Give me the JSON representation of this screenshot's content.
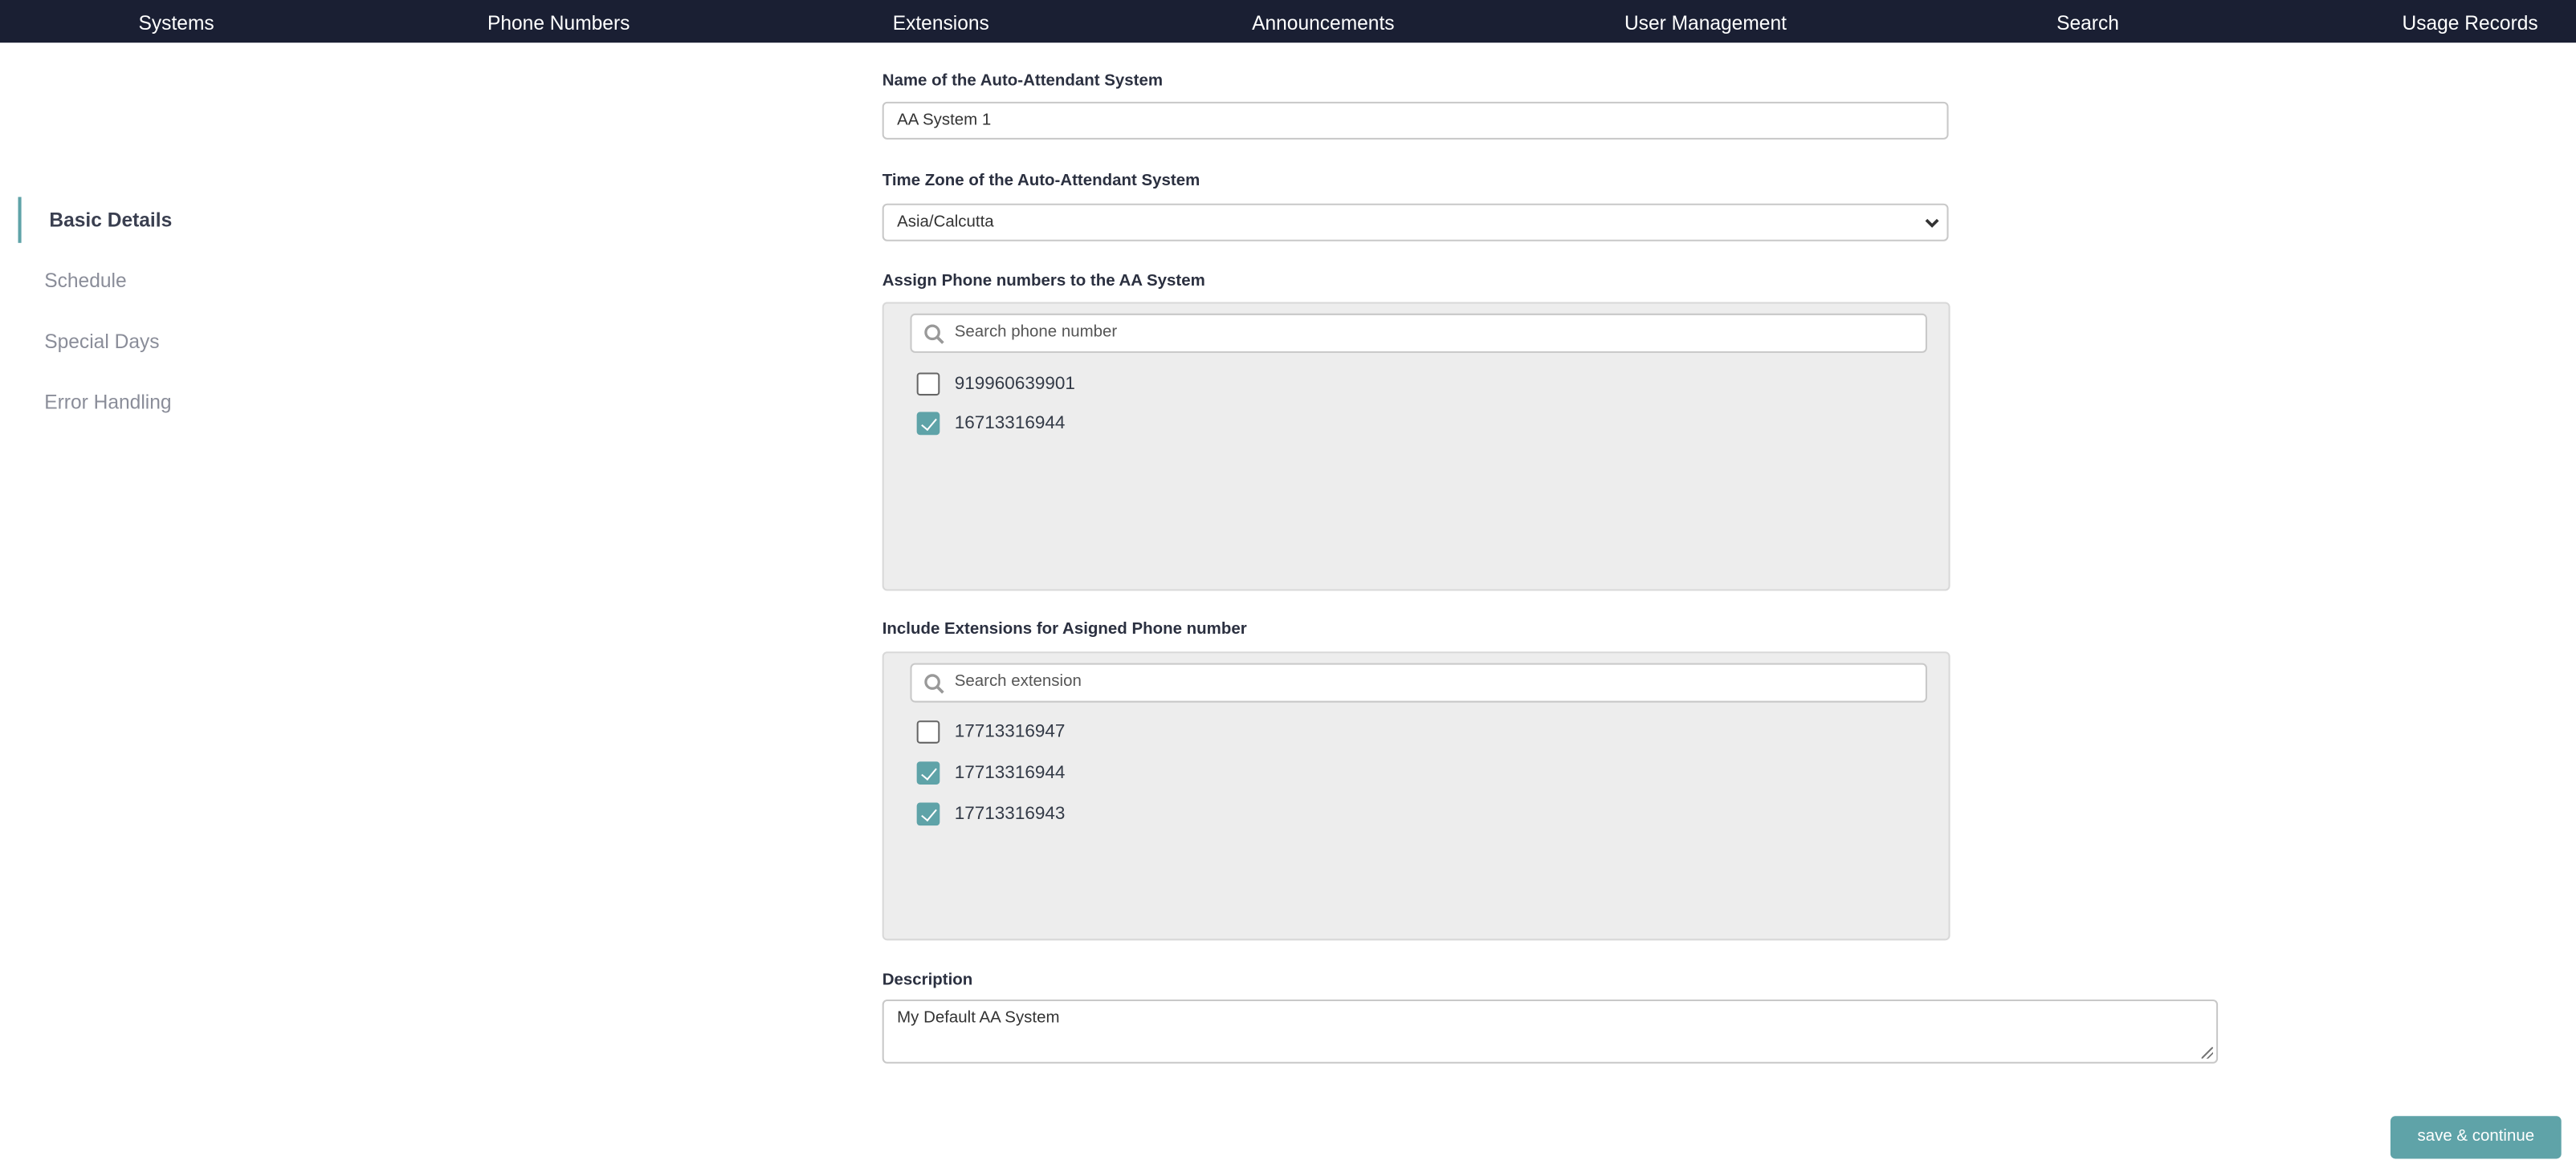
{
  "nav": [
    "Systems",
    "Phone Numbers",
    "Extensions",
    "Announcements",
    "User Management",
    "Search",
    "Usage Records"
  ],
  "sidebar": {
    "items": [
      {
        "label": "Basic Details",
        "active": true
      },
      {
        "label": "Schedule",
        "active": false
      },
      {
        "label": "Special Days",
        "active": false
      },
      {
        "label": "Error Handling",
        "active": false
      }
    ]
  },
  "form": {
    "name_label": "Name of the Auto-Attendant System",
    "name_value": "AA System 1",
    "tz_label": "Time Zone of the Auto-Attendant System",
    "tz_value": "Asia/Calcutta",
    "phones_label": "Assign Phone numbers to the AA System",
    "phones_search_placeholder": "Search phone number",
    "phones": [
      {
        "number": "919960639901",
        "checked": false
      },
      {
        "number": "16713316944",
        "checked": true
      }
    ],
    "ext_label": "Include Extensions for Asigned Phone number",
    "ext_search_placeholder": "Search extension",
    "extensions": [
      {
        "number": "17713316947",
        "checked": false
      },
      {
        "number": "17713316944",
        "checked": true
      },
      {
        "number": "17713316943",
        "checked": true
      }
    ],
    "desc_label": "Description",
    "desc_value": "My Default AA System",
    "save_label": "save & continue"
  },
  "colors": {
    "nav_bg": "#1a1f33",
    "accent": "#5fa3a8"
  }
}
